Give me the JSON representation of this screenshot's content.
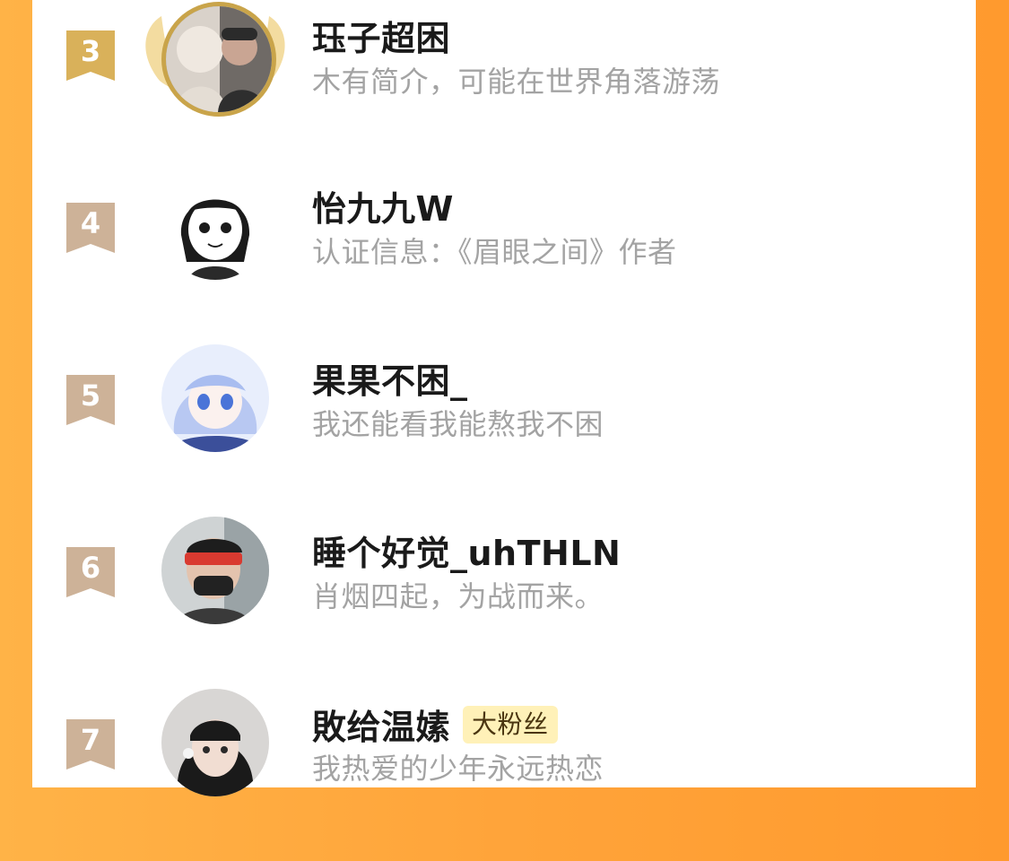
{
  "leaderboard": {
    "entries": [
      {
        "rank": "3",
        "name": "珏子超困",
        "bio": "木有简介，可能在世界角落游荡",
        "badge": ""
      },
      {
        "rank": "4",
        "name": "怡九九W",
        "bio": "认证信息：《眉眼之间》作者",
        "badge": ""
      },
      {
        "rank": "5",
        "name": "果果不困_",
        "bio": "我还能看我能熬我不困",
        "badge": ""
      },
      {
        "rank": "6",
        "name": "睡个好觉_uhTHLN",
        "bio": "肖烟四起，为战而来。",
        "badge": ""
      },
      {
        "rank": "7",
        "name": "敗给温嫊",
        "bio": "我热爱的少年永远热恋",
        "badge": "大粉丝"
      }
    ]
  },
  "colors": {
    "background": "#ffa43a",
    "card": "#ffffff",
    "rank3": "#d9b15a",
    "rank_other": "#cdb298",
    "name": "#1a1a1a",
    "bio": "#a3a3a3",
    "badge_bg": "#fff1b8"
  },
  "icons": {
    "rank_flag": "bookmark-ribbon-icon",
    "top3_frame": "golden-wings-frame-icon"
  }
}
